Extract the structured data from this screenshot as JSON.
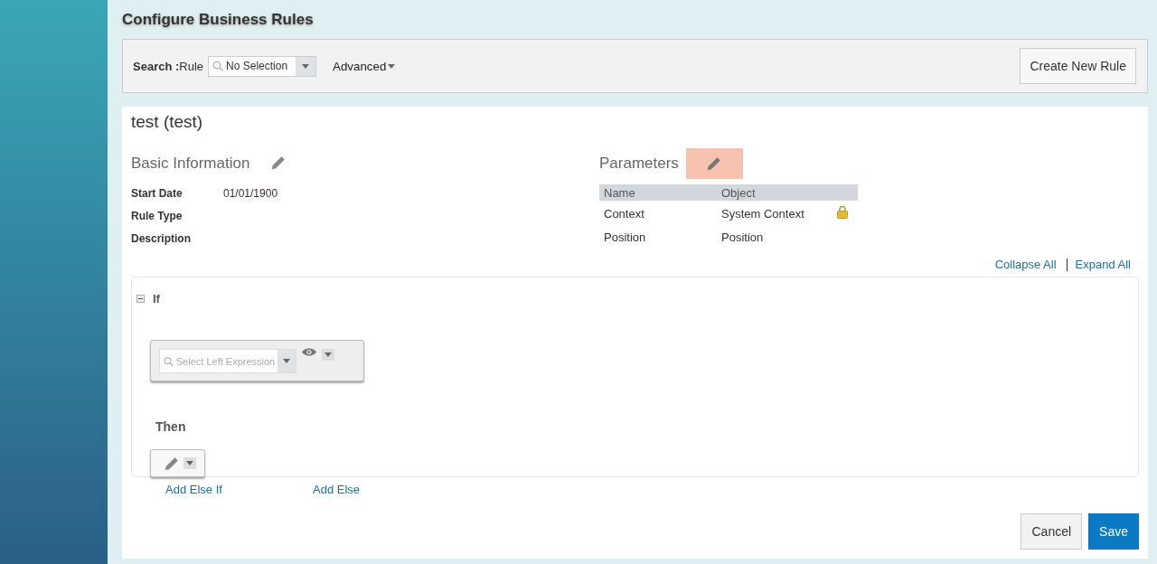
{
  "page_title": "Configure Business Rules",
  "search": {
    "label": "Search :",
    "field_label": "Rule",
    "value": "No Selection",
    "advanced": "Advanced"
  },
  "create_button": "Create New Rule",
  "rule": {
    "title": "test (test)",
    "basic_information": {
      "heading": "Basic Information",
      "fields": [
        {
          "label": "Start Date",
          "value": "01/01/1900"
        },
        {
          "label": "Rule Type"
        },
        {
          "label": "Description"
        }
      ]
    },
    "parameters": {
      "heading": "Parameters",
      "edit_highlighted": true,
      "columns": [
        "Name",
        "Object"
      ],
      "rows": [
        {
          "name": "Context",
          "object": "System Context",
          "locked": true
        },
        {
          "name": "Position",
          "object": "Position",
          "locked": false
        }
      ]
    },
    "collapse_all": "Collapse All",
    "expand_all": "Expand All",
    "if_block": {
      "label": "If",
      "expanded": true,
      "left_expression_placeholder": "Select Left Expression",
      "then_label": "Then"
    },
    "add_else_if": "Add Else If",
    "add_else": "Add Else"
  },
  "buttons": [
    "Cancel",
    "Save"
  ]
}
